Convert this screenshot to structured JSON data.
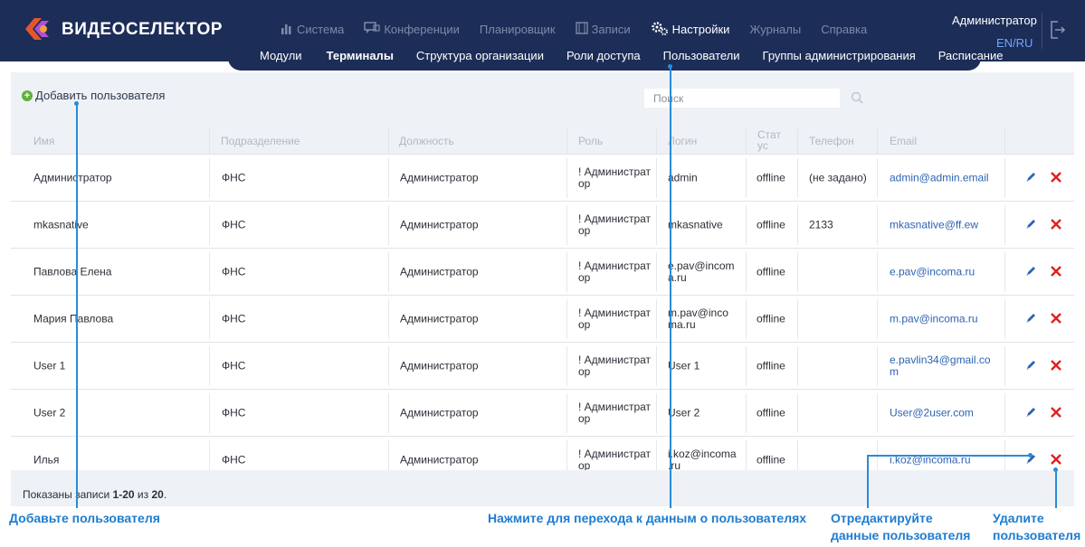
{
  "app": {
    "logo_text": "ВИДЕОСЕЛЕКТОР"
  },
  "nav": {
    "main": [
      {
        "label": "Система",
        "icon": "chart-icon"
      },
      {
        "label": "Конференции",
        "icon": "chat-icon"
      },
      {
        "label": "Планировщик",
        "icon": ""
      },
      {
        "label": "Записи",
        "icon": "film-icon"
      },
      {
        "label": "Настройки",
        "icon": "gears-icon"
      },
      {
        "label": "Журналы",
        "icon": ""
      },
      {
        "label": "Справка",
        "icon": ""
      }
    ],
    "active_main": "Настройки",
    "sub": [
      "Модули",
      "Терминалы",
      "Структура организации",
      "Роли доступа",
      "Пользователи",
      "Группы администрирования",
      "Расписание"
    ],
    "active_sub": "Терминалы"
  },
  "header": {
    "user": "Администратор",
    "lang": "EN/RU"
  },
  "toolbar": {
    "add_user_label": "Добавить пользователя",
    "search_placeholder": "Поиск"
  },
  "table": {
    "columns": [
      "Имя",
      "Подразделение",
      "Должность",
      "Роль",
      "Логин",
      "Стат ус",
      "Телефон",
      "Email"
    ],
    "rows": [
      {
        "name": "Администратор",
        "dept": "ФНС",
        "position": "Администратор",
        "role": "! Администрат ор",
        "login": "admin",
        "status": "offline",
        "phone": "(не задано)",
        "email": "admin@admin.email"
      },
      {
        "name": "mkasnative",
        "dept": "ФНС",
        "position": "Администратор",
        "role": "! Администрат ор",
        "login": "mkasnative",
        "status": "offline",
        "phone": "2133",
        "email": "mkasnative@ff.ew"
      },
      {
        "name": "Павлова Елена",
        "dept": "ФНС",
        "position": "Администратор",
        "role": "! Администрат ор",
        "login": "e.pav@incom a.ru",
        "status": "offline",
        "phone": "",
        "email": "e.pav@incoma.ru"
      },
      {
        "name": "Мария Павлова",
        "dept": "ФНС",
        "position": "Администратор",
        "role": "! Администрат ор",
        "login": "m.pav@inco ma.ru",
        "status": "offline",
        "phone": "",
        "email": "m.pav@incoma.ru"
      },
      {
        "name": "User 1",
        "dept": "ФНС",
        "position": "Администратор",
        "role": "! Администрат ор",
        "login": "User 1",
        "status": "offline",
        "phone": "",
        "email": "e.pavlin34@gmail.co m"
      },
      {
        "name": "User 2",
        "dept": "ФНС",
        "position": "Администратор",
        "role": "! Администрат ор",
        "login": "User 2",
        "status": "offline",
        "phone": "",
        "email": "User@2user.com"
      },
      {
        "name": "Илья",
        "dept": "ФНС",
        "position": "Администратор",
        "role": "! Администрат ор",
        "login": "i.koz@incoma .ru",
        "status": "offline",
        "phone": "",
        "email": "i.koz@incoma.ru"
      }
    ]
  },
  "footer": {
    "prefix": "Показаны записи",
    "range": "1-20",
    "of": "из",
    "total": "20"
  },
  "callouts": {
    "add_user": "Добавьте пользователя",
    "open_user": "Нажмите для перехода к данным о пользователях",
    "edit_user": "Отредактируйте данные пользователя",
    "delete_user": "Удалите пользователя"
  },
  "colors": {
    "header": "#1c2d57",
    "accent": "#2a8bd8",
    "link": "#2d64b3",
    "delete": "#e02020",
    "add": "#5cb23a"
  }
}
